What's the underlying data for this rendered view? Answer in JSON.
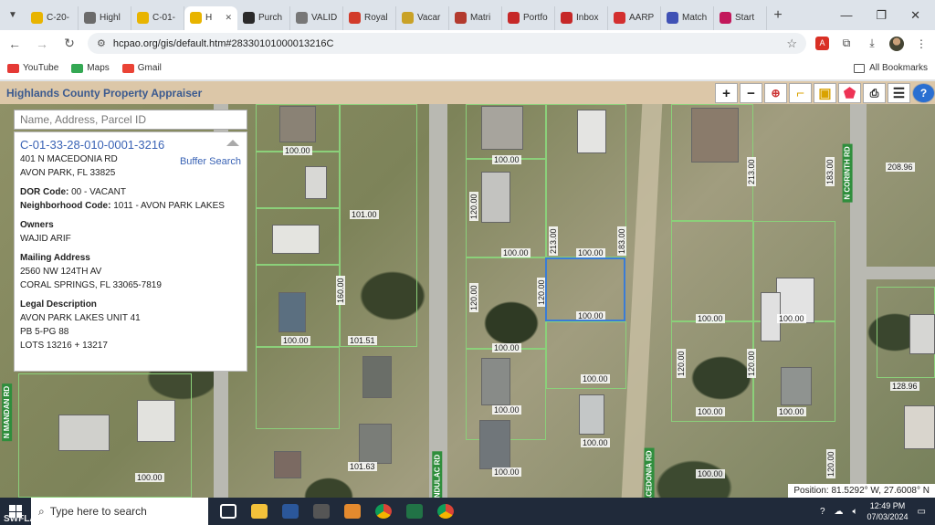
{
  "browser": {
    "tabs": [
      {
        "label": "C-20-",
        "color": "#e8b400"
      },
      {
        "label": "Highl",
        "color": "#6b6b6b"
      },
      {
        "label": "C-01-",
        "color": "#e8b400"
      },
      {
        "label": "H",
        "color": "#e8b400",
        "active": true
      },
      {
        "label": "Purch",
        "color": "#2a2a2a"
      },
      {
        "label": "VALID",
        "color": "#777777"
      },
      {
        "label": "Royal",
        "color": "#d23b2a"
      },
      {
        "label": "Vacar",
        "color": "#c9a227"
      },
      {
        "label": "Matri",
        "color": "#b33a2e"
      },
      {
        "label": "Portfo",
        "color": "#c62828"
      },
      {
        "label": "Inbox",
        "color": "#c62828"
      },
      {
        "label": "AARP",
        "color": "#d32f2f"
      },
      {
        "label": "Match",
        "color": "#3f51b5"
      },
      {
        "label": "Start",
        "color": "#c2185b"
      }
    ],
    "url": "hcpao.org/gis/default.htm#28330101000013216C",
    "bookmarks": [
      {
        "label": "YouTube",
        "color": "#e53935"
      },
      {
        "label": "Maps",
        "color": "#34a853"
      },
      {
        "label": "Gmail",
        "color": "#ea4335"
      }
    ],
    "all_bookmarks": "All Bookmarks"
  },
  "app": {
    "title": "Highlands County Property Appraiser",
    "tools": [
      "zoom-in-icon",
      "zoom-out-icon",
      "zoom-box-icon",
      "measure-icon",
      "select-icon",
      "identify-icon",
      "print-icon",
      "menu-icon",
      "help-icon"
    ]
  },
  "search": {
    "placeholder": "Name, Address, Parcel ID"
  },
  "parcel": {
    "id": "C-01-33-28-010-0001-3216",
    "address_line1": "401 N MACEDONIA RD",
    "address_line2": "AVON PARK, FL 33825",
    "buffer_search": "Buffer Search",
    "dor_label": "DOR Code:",
    "dor_value": "00 - VACANT",
    "nbhd_label": "Neighborhood Code:",
    "nbhd_value": "1011 - AVON PARK LAKES",
    "owners_label": "Owners",
    "owner": "WAJID ARIF",
    "mailing_label": "Mailing Address",
    "mailing_line1": "2560 NW 124TH AV",
    "mailing_line2": "CORAL SPRINGS, FL 33065-7819",
    "legal_label": "Legal Description",
    "legal_line1": "AVON PARK LAKES UNIT 41",
    "legal_line2": "PB 5-PG 88",
    "legal_line3": "LOTS 13216 + 13217"
  },
  "map": {
    "roads": {
      "corinth": "N CORINTH RD",
      "mandan": "N MANDAN RD",
      "fondulac": "NDULAC RD",
      "macedonia": "ACEDONIA RD"
    },
    "position": "Position: 81.5292° W, 27.6008° N"
  },
  "taskbar": {
    "search_placeholder": "Type here to search",
    "time": "12:49 PM",
    "date": "07/03/2024",
    "watermark": "SWFLAMLS"
  }
}
